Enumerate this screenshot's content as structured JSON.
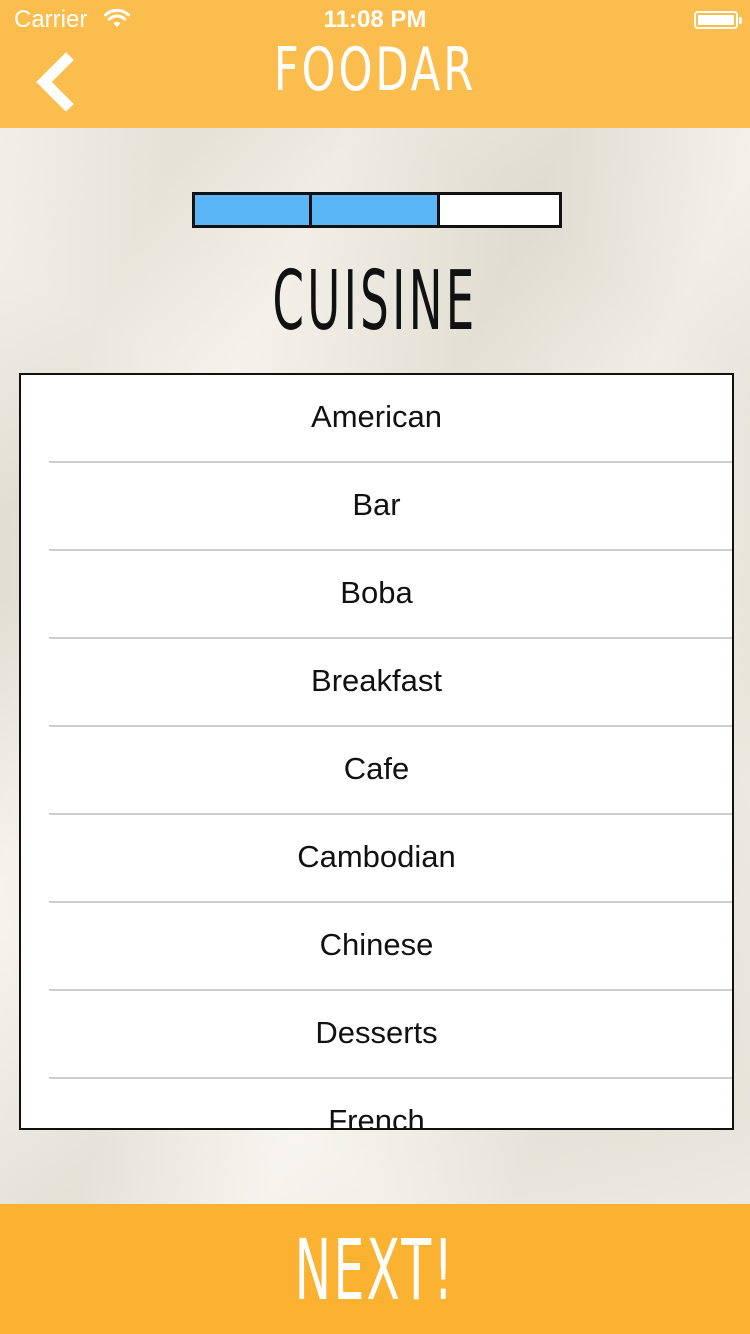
{
  "status_bar": {
    "carrier": "Carrier",
    "time": "11:08 PM"
  },
  "header": {
    "title": "FOODAR",
    "background": "#fbbd4d",
    "back_icon": "chevron-left-icon"
  },
  "progress": {
    "steps_total": 3,
    "steps_completed": 2,
    "filled_color": "#5bb6f7"
  },
  "section": {
    "title": "CUISINE"
  },
  "cuisines": [
    "American",
    "Bar",
    "Boba",
    "Breakfast",
    "Cafe",
    "Cambodian",
    "Chinese",
    "Desserts",
    "French"
  ],
  "footer": {
    "next_label": "NEXT!",
    "background": "#fbb230"
  }
}
